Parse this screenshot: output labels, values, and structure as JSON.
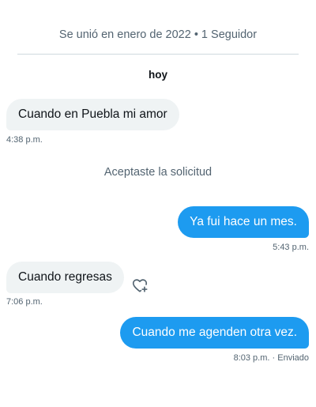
{
  "header": {
    "joined_text": "Se unió en enero de 2022 • 1 Seguidor",
    "day_label": "hoy"
  },
  "messages": [
    {
      "direction": "incoming",
      "text": "Cuando en Puebla mi amor",
      "time": "4:38 p.m."
    },
    {
      "direction": "outgoing",
      "text": "Ya fui hace un mes.",
      "time": "5:43 p.m."
    },
    {
      "direction": "incoming",
      "text": "Cuando regresas",
      "time": "7:06 p.m."
    },
    {
      "direction": "outgoing",
      "text": "Cuando me agenden otra vez.",
      "time": "8:03 p.m.",
      "status": "· Enviado"
    }
  ],
  "system_notice": "Aceptaste la solicitud",
  "icons": {
    "react": "heart-plus-icon"
  },
  "colors": {
    "outgoing_bubble": "#1d9bf0",
    "incoming_bubble": "#eff3f4",
    "muted_text": "#536471"
  }
}
